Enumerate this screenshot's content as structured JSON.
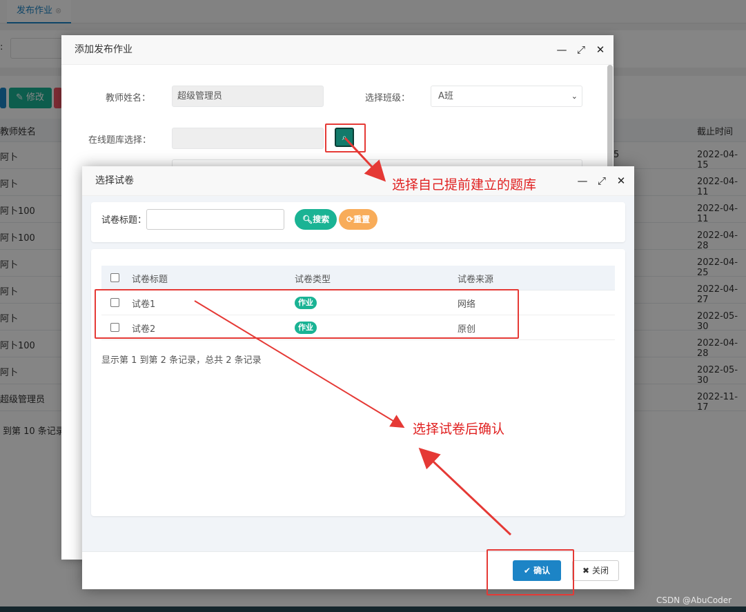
{
  "background": {
    "tab_label": "发布作业",
    "search_label_fragment": ":",
    "edit_button": "修改",
    "col_teacher": "教师姓名",
    "col_deadline": "截止时间",
    "rows": [
      {
        "name": "阿卜",
        "mid": "5",
        "date": "2022-04-15"
      },
      {
        "name": "阿卜",
        "mid": "",
        "date": "2022-04-11"
      },
      {
        "name": "阿卜100",
        "mid": "",
        "date": "2022-04-11"
      },
      {
        "name": "阿卜100",
        "mid": "",
        "date": "2022-04-28"
      },
      {
        "name": "阿卜",
        "mid": "",
        "date": "2022-04-25"
      },
      {
        "name": "阿卜",
        "mid": "",
        "date": "2022-04-27"
      },
      {
        "name": "阿卜",
        "mid": "",
        "date": "2022-05-30"
      },
      {
        "name": "阿卜100",
        "mid": "",
        "date": "2022-04-28"
      },
      {
        "name": "阿卜",
        "mid": "",
        "date": "2022-05-30"
      },
      {
        "name": "超级管理员",
        "mid": "",
        "date": "2022-11-17"
      }
    ],
    "page_info": "到第 10 条记录"
  },
  "outer_dialog": {
    "title": "添加发布作业",
    "teacher_label": "教师姓名：",
    "teacher_value": "超级管理员",
    "class_label": "选择班级：",
    "class_value": "A班",
    "bank_label": "在线题库选择：",
    "bank_value": ""
  },
  "inner_dialog": {
    "title": "选择试卷",
    "search_label": "试卷标题：",
    "search_placeholder": "",
    "search_button": "搜索",
    "reset_button": "重置",
    "columns": [
      "试卷标题",
      "试卷类型",
      "试卷来源"
    ],
    "rows": [
      {
        "title": "试卷1",
        "type": "作业",
        "source": "网络"
      },
      {
        "title": "试卷2",
        "type": "作业",
        "source": "原创"
      }
    ],
    "table_info": "显示第 1 到第 2 条记录，总共 2 条记录",
    "confirm_button": "确认",
    "close_button": "关闭"
  },
  "annotations": {
    "pick_bank": "选择自己提前建立的题库",
    "confirm_paper": "选择试卷后确认"
  },
  "watermark": "CSDN @AbuCoder",
  "icons": {
    "minimize": "minimize-icon",
    "maximize": "maximize-icon",
    "close": "close-icon",
    "search": "search-icon",
    "refresh": "refresh-icon",
    "check": "check-icon",
    "times": "times-icon",
    "edit": "edit-icon"
  },
  "colors": {
    "primary": "#1c84c6",
    "success": "#1ab394",
    "warning": "#f8ac59",
    "danger": "#ed5565",
    "annotation": "#e53935"
  }
}
